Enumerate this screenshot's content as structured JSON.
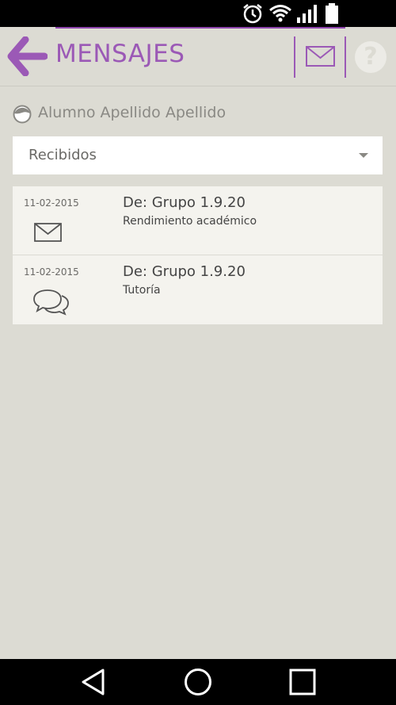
{
  "header": {
    "title": "MENSAJES",
    "help_label": "?"
  },
  "user": {
    "name": "Alumno Apellido Apellido"
  },
  "folder_select": {
    "selected": "Recibidos"
  },
  "messages": [
    {
      "date": "11-02-2015",
      "from": "De: Grupo 1.9.20",
      "subject": "Rendimiento académico",
      "icon": "envelope-icon"
    },
    {
      "date": "11-02-2015",
      "from": "De: Grupo 1.9.20",
      "subject": "Tutoría",
      "icon": "chat-bubbles-icon"
    }
  ],
  "colors": {
    "accent": "#9b59b6",
    "background": "#dcdbd3",
    "card": "#f4f3ee"
  }
}
